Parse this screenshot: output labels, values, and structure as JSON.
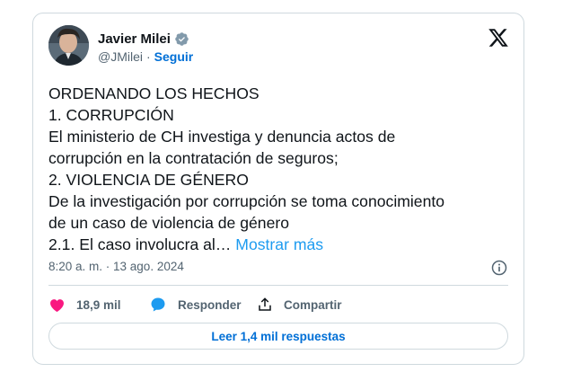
{
  "author": {
    "name": "Javier Milei",
    "handle": "@JMilei",
    "separator": "·",
    "follow_label": "Seguir"
  },
  "icons": {
    "verified": "verified-badge-icon",
    "logo": "x-logo-icon",
    "info": "info-icon",
    "like": "heart-icon",
    "reply": "speech-bubble-icon",
    "share": "share-upload-icon"
  },
  "post": {
    "lines": [
      "ORDENANDO LOS HECHOS",
      "1. CORRUPCIÓN",
      "El ministerio de CH investiga y denuncia actos de",
      "corrupción en la contratación de seguros;",
      "2. VIOLENCIA DE GÉNERO",
      "De la investigación por corrupción se toma conocimiento",
      "de un caso de violencia de género"
    ],
    "last_line": "2.1. El caso involucra al…",
    "show_more": "Mostrar más",
    "timestamp": "8:20 a. m. · 13 ago. 2024"
  },
  "actions": {
    "like_count": "18,9 mil",
    "reply_label": "Responder",
    "share_label": "Compartir"
  },
  "replies_button": "Leer 1,4 mil respuestas",
  "colors": {
    "accent": "#1d9bf0",
    "link": "#006fd6",
    "like": "#f91880",
    "text": "#0f1419",
    "muted": "#536471",
    "border": "#cfd9de"
  }
}
